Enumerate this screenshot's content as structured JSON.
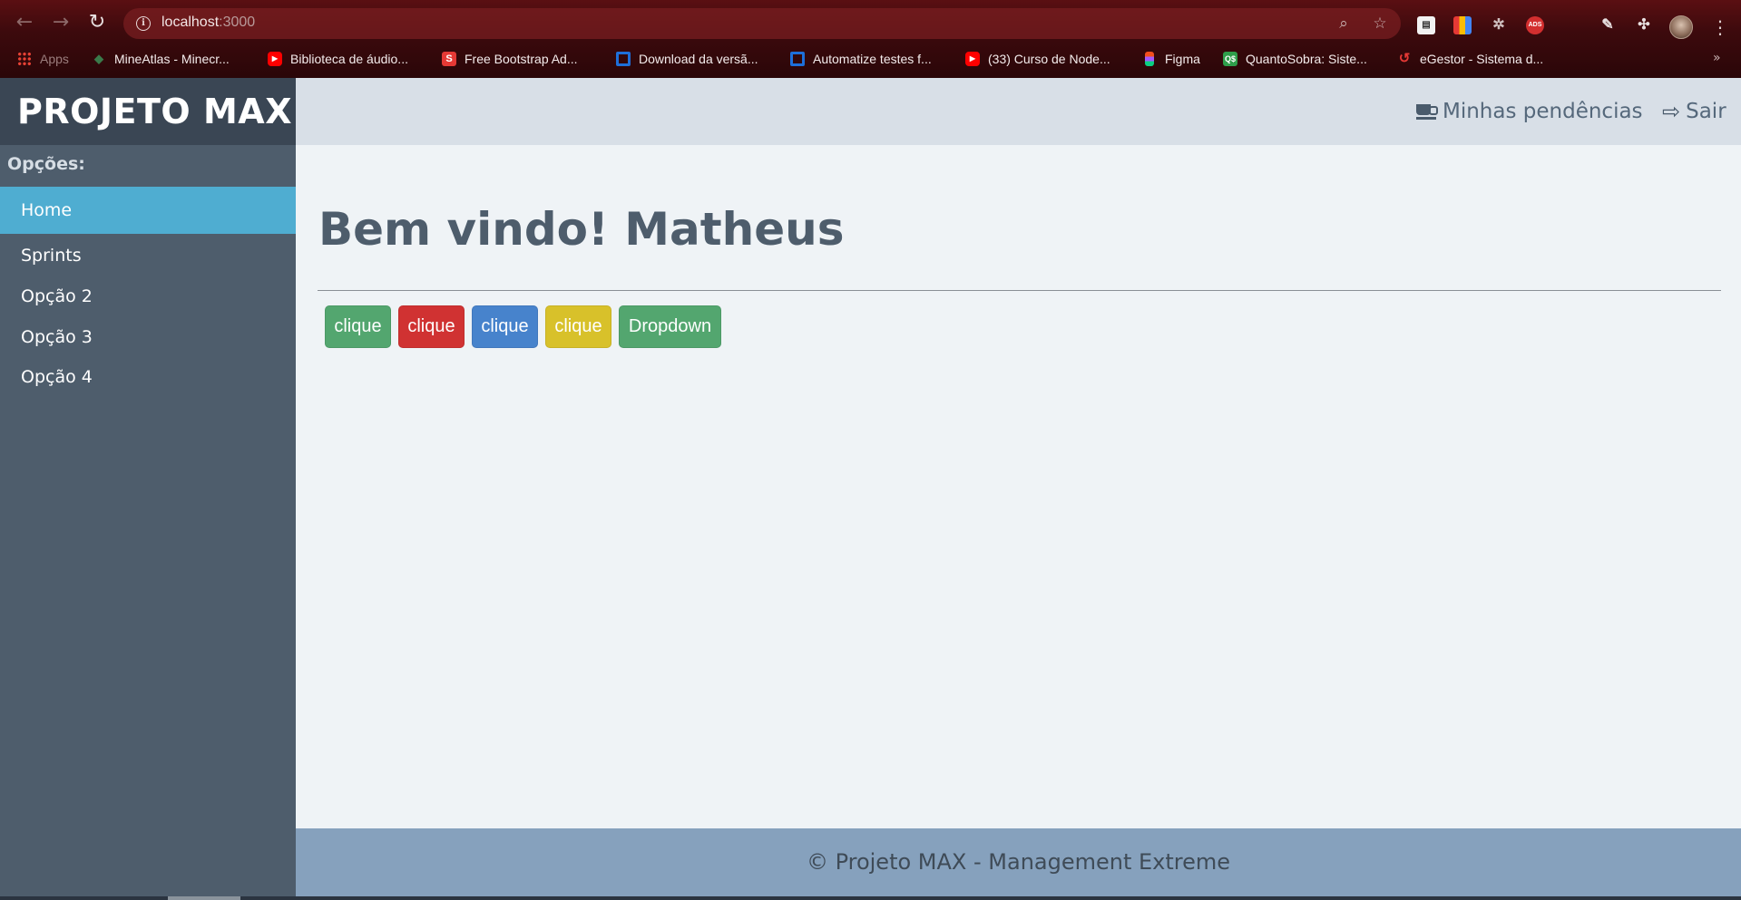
{
  "browser": {
    "url_host": "localhost",
    "url_port": ":3000",
    "bookmarks": [
      {
        "label": "Apps",
        "icon": "apps-grid-icon",
        "color": "#e94235"
      },
      {
        "label": "MineAtlas - Minecr...",
        "icon": "mineatlas-icon",
        "color": "#3a7a4a"
      },
      {
        "label": "Biblioteca de áudio...",
        "icon": "youtube-icon",
        "color": "#ff0000"
      },
      {
        "label": "Free Bootstrap Ad...",
        "icon": "s-logo-icon",
        "color": "#e53935"
      },
      {
        "label": "Download da versã...",
        "icon": "square-logo-icon",
        "color": "#1e6fd9"
      },
      {
        "label": "Automatize testes f...",
        "icon": "square-logo-icon",
        "color": "#1e6fd9"
      },
      {
        "label": "(33) Curso de Node...",
        "icon": "youtube-icon",
        "color": "#ff0000"
      },
      {
        "label": "Figma",
        "icon": "figma-icon",
        "color": "#f24e1e"
      },
      {
        "label": "QuantoSobra: Siste...",
        "icon": "quantosobra-icon",
        "color": "#2e9d4a"
      },
      {
        "label": "eGestor - Sistema d...",
        "icon": "egestor-icon",
        "color": "#e53935"
      }
    ],
    "more_label": "»"
  },
  "app": {
    "brand": "PROJETO MAX",
    "sidebar": {
      "options_label": "Opções:",
      "items": [
        {
          "label": "Home",
          "active": true
        },
        {
          "label": "Sprints",
          "active": false
        },
        {
          "label": "Opção 2",
          "active": false
        },
        {
          "label": "Opção 3",
          "active": false
        },
        {
          "label": "Opção 4",
          "active": false
        }
      ]
    },
    "topbar": {
      "pending_label": "Minhas pendências",
      "logout_label": "Sair"
    },
    "main": {
      "title": "Bem vindo! Matheus",
      "buttons": [
        {
          "label": "clique",
          "color": "#53a66f"
        },
        {
          "label": "clique",
          "color": "#d03232"
        },
        {
          "label": "clique",
          "color": "#4783cc"
        },
        {
          "label": "clique",
          "color": "#d8c12a"
        },
        {
          "label": "Dropdown",
          "color": "#53a66f"
        }
      ]
    },
    "footer": "© Projeto MAX - Management Extreme"
  },
  "colors": {
    "sidebar_bg": "#4e5d6c",
    "brand_bg": "#3a4654",
    "active_item": "#4fadd1",
    "topbar_bg": "#d8dfe7",
    "main_bg": "#eff3f6",
    "footer_bg": "#86a1bd"
  }
}
